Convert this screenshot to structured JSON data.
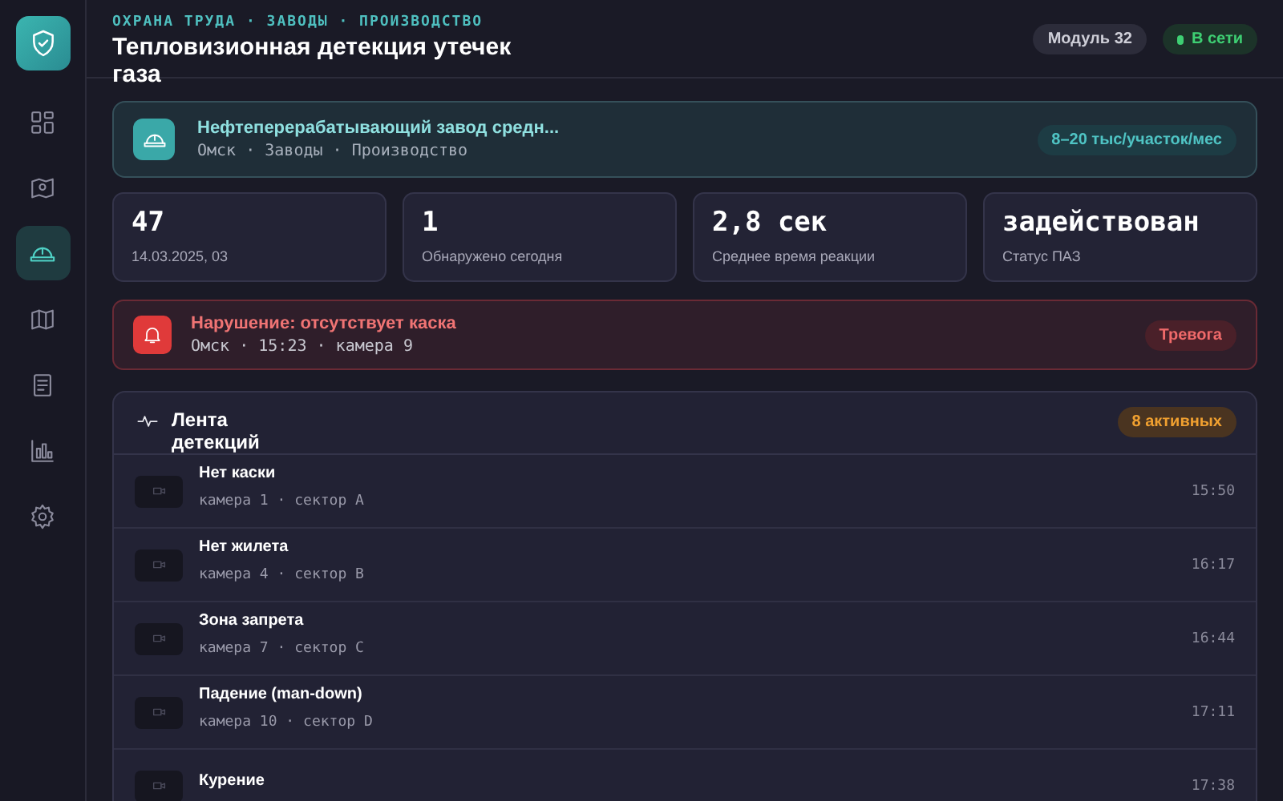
{
  "sidebar": {
    "items": [
      {
        "kind": "grid",
        "selected": false
      },
      {
        "kind": "camera",
        "selected": false
      },
      {
        "kind": "helmet",
        "selected": true
      },
      {
        "kind": "map",
        "selected": false
      },
      {
        "kind": "document",
        "selected": false
      },
      {
        "kind": "chart",
        "selected": false
      },
      {
        "kind": "gear",
        "selected": false
      }
    ]
  },
  "header": {
    "breadcrumb": "ОХРАНА ТРУДА · ЗАВОДЫ · ПРОИЗВОДСТВО",
    "title": "Тепловизионная детекция утечек газа",
    "module": "Модуль 32",
    "status": "В сети",
    "online": true
  },
  "site": {
    "name": "Нефтеперерабатывающий завод средн...",
    "meta": "Омск · Заводы · Производство",
    "price": "8–20 тыс/участок/мес"
  },
  "stats": [
    {
      "value": "47",
      "label": "14.03.2025, 03"
    },
    {
      "value": "1",
      "label": "Обнаружено сегодня"
    },
    {
      "value": "2,8 сек",
      "label": "Среднее время реакции"
    },
    {
      "value": "задействован",
      "label": "Статус ПАЗ"
    }
  ],
  "alert": {
    "title": "Нарушение: отсутствует каска",
    "meta": "Омск · 15:23 · камера 9",
    "badge": "Тревога"
  },
  "feed": {
    "title": "Лента детекций",
    "badge": "8 активных",
    "rows": [
      {
        "title": "Нет каски",
        "meta": "камера 1 · сектор A",
        "time": "15:50"
      },
      {
        "title": "Нет жилета",
        "meta": "камера 4 · сектор B",
        "time": "16:17"
      },
      {
        "title": "Зона запрета",
        "meta": "камера 7 · сектор C",
        "time": "16:44"
      },
      {
        "title": "Падение (man-down)",
        "meta": "камера 10 · сектор D",
        "time": "17:11"
      },
      {
        "title": "Курение",
        "time": "17:38"
      }
    ]
  }
}
